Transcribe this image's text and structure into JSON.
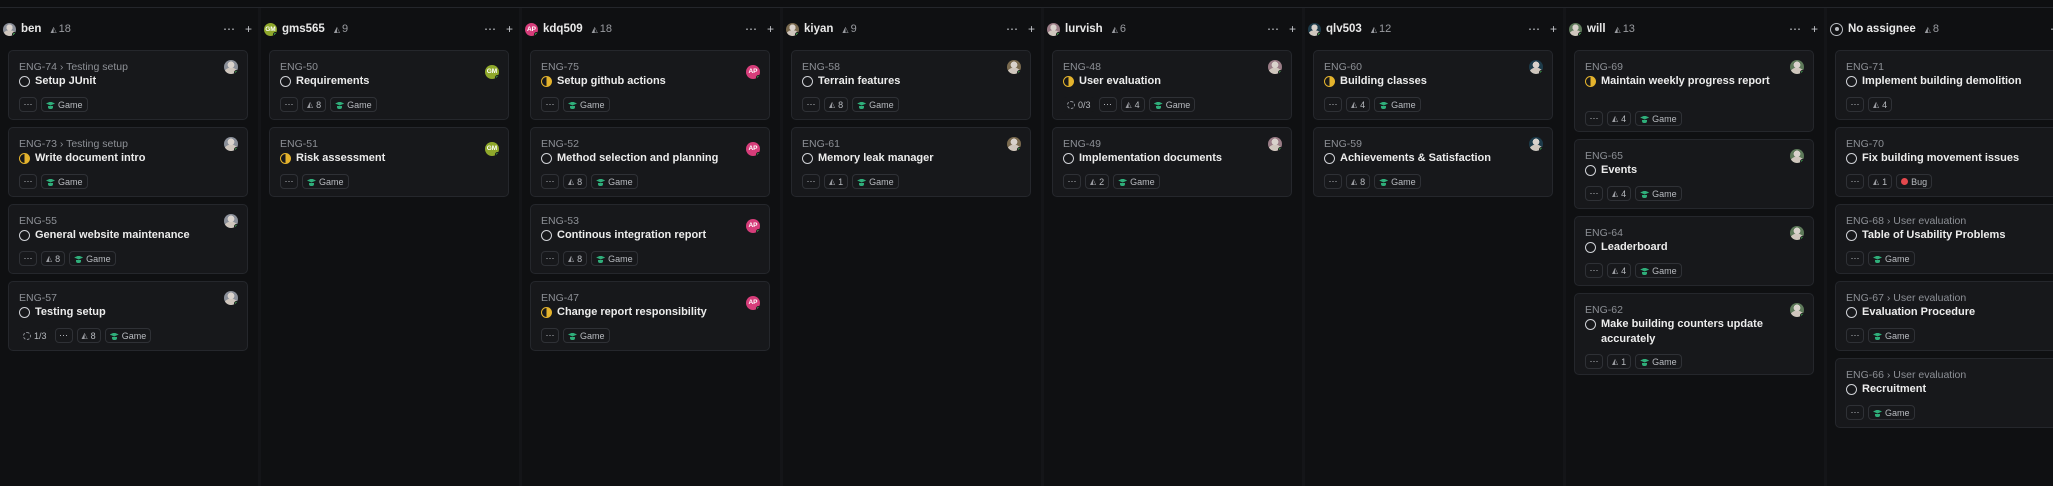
{
  "columns": [
    {
      "name": "ben",
      "estimate": "18",
      "avatar": {
        "initials": "",
        "color": "#8a8f99"
      },
      "cards": [
        {
          "id": "ENG-74",
          "parent": "Testing setup",
          "title": "Setup JUnit",
          "status": "todo",
          "props": [
            {
              "type": "more"
            },
            {
              "type": "label",
              "text": "Game"
            }
          ]
        },
        {
          "id": "ENG-73",
          "parent": "Testing setup",
          "title": "Write document intro",
          "status": "progress",
          "props": [
            {
              "type": "more"
            },
            {
              "type": "label",
              "text": "Game"
            }
          ]
        },
        {
          "id": "ENG-55",
          "parent": "",
          "title": "General website maintenance",
          "status": "todo",
          "props": [
            {
              "type": "more"
            },
            {
              "type": "estimate",
              "text": "8"
            },
            {
              "type": "label",
              "text": "Game"
            }
          ]
        },
        {
          "id": "ENG-57",
          "parent": "",
          "title": "Testing setup",
          "status": "todo",
          "props": [
            {
              "type": "subissues",
              "text": "1/3"
            },
            {
              "type": "more"
            },
            {
              "type": "estimate",
              "text": "8"
            },
            {
              "type": "label",
              "text": "Game"
            }
          ]
        }
      ]
    },
    {
      "name": "gms565",
      "estimate": "9",
      "avatar": {
        "initials": "GM",
        "color": "#8fa82b"
      },
      "cards": [
        {
          "id": "ENG-50",
          "parent": "",
          "title": "Requirements",
          "status": "todo",
          "props": [
            {
              "type": "more"
            },
            {
              "type": "estimate",
              "text": "8"
            },
            {
              "type": "label",
              "text": "Game"
            }
          ]
        },
        {
          "id": "ENG-51",
          "parent": "",
          "title": "Risk assessment",
          "status": "progress",
          "props": [
            {
              "type": "more"
            },
            {
              "type": "label",
              "text": "Game"
            }
          ]
        }
      ]
    },
    {
      "name": "kdq509",
      "estimate": "18",
      "avatar": {
        "initials": "AP",
        "color": "#d63d7a"
      },
      "cards": [
        {
          "id": "ENG-75",
          "parent": "",
          "title": "Setup github actions",
          "status": "progress",
          "props": [
            {
              "type": "more"
            },
            {
              "type": "label",
              "text": "Game"
            }
          ]
        },
        {
          "id": "ENG-52",
          "parent": "",
          "title": "Method selection and planning",
          "status": "todo",
          "props": [
            {
              "type": "more"
            },
            {
              "type": "estimate",
              "text": "8"
            },
            {
              "type": "label",
              "text": "Game"
            }
          ]
        },
        {
          "id": "ENG-53",
          "parent": "",
          "title": "Continous integration report",
          "status": "todo",
          "props": [
            {
              "type": "more"
            },
            {
              "type": "estimate",
              "text": "8"
            },
            {
              "type": "label",
              "text": "Game"
            }
          ]
        },
        {
          "id": "ENG-47",
          "parent": "",
          "title": "Change report responsibility",
          "status": "progress",
          "props": [
            {
              "type": "more"
            },
            {
              "type": "label",
              "text": "Game"
            }
          ]
        }
      ]
    },
    {
      "name": "kiyan",
      "estimate": "9",
      "avatar": {
        "initials": "",
        "color": "#7a6a4f"
      },
      "cards": [
        {
          "id": "ENG-58",
          "parent": "",
          "title": "Terrain features",
          "status": "todo",
          "props": [
            {
              "type": "more"
            },
            {
              "type": "estimate",
              "text": "8"
            },
            {
              "type": "label",
              "text": "Game"
            }
          ]
        },
        {
          "id": "ENG-61",
          "parent": "",
          "title": "Memory leak manager",
          "status": "todo",
          "props": [
            {
              "type": "more"
            },
            {
              "type": "estimate",
              "text": "1"
            },
            {
              "type": "label",
              "text": "Game"
            }
          ]
        }
      ]
    },
    {
      "name": "lurvish",
      "estimate": "6",
      "avatar": {
        "initials": "",
        "color": "#9a7c86"
      },
      "cards": [
        {
          "id": "ENG-48",
          "parent": "",
          "title": "User evaluation",
          "status": "progress",
          "props": [
            {
              "type": "subissues",
              "text": "0/3"
            },
            {
              "type": "more"
            },
            {
              "type": "estimate",
              "text": "4"
            },
            {
              "type": "label",
              "text": "Game"
            }
          ]
        },
        {
          "id": "ENG-49",
          "parent": "",
          "title": "Implementation documents",
          "status": "todo",
          "props": [
            {
              "type": "more"
            },
            {
              "type": "estimate",
              "text": "2"
            },
            {
              "type": "label",
              "text": "Game"
            }
          ]
        }
      ]
    },
    {
      "name": "qlv503",
      "estimate": "12",
      "avatar": {
        "initials": "",
        "color": "#1d3b4a"
      },
      "cards": [
        {
          "id": "ENG-60",
          "parent": "",
          "title": "Building classes",
          "status": "progress",
          "props": [
            {
              "type": "more"
            },
            {
              "type": "estimate",
              "text": "4"
            },
            {
              "type": "label",
              "text": "Game"
            }
          ]
        },
        {
          "id": "ENG-59",
          "parent": "",
          "title": "Achievements & Satisfaction",
          "status": "todo",
          "props": [
            {
              "type": "more"
            },
            {
              "type": "estimate",
              "text": "8"
            },
            {
              "type": "label",
              "text": "Game"
            }
          ]
        }
      ]
    },
    {
      "name": "will",
      "estimate": "13",
      "avatar": {
        "initials": "",
        "color": "#5e7a5a"
      },
      "cards": [
        {
          "id": "ENG-69",
          "parent": "",
          "title": "Maintain weekly progress report",
          "status": "progress",
          "props": [
            {
              "type": "more"
            },
            {
              "type": "estimate",
              "text": "4"
            },
            {
              "type": "label",
              "text": "Game"
            }
          ]
        },
        {
          "id": "ENG-65",
          "parent": "",
          "title": "Events",
          "status": "todo",
          "props": [
            {
              "type": "more"
            },
            {
              "type": "estimate",
              "text": "4"
            },
            {
              "type": "label",
              "text": "Game"
            }
          ]
        },
        {
          "id": "ENG-64",
          "parent": "",
          "title": "Leaderboard",
          "status": "todo",
          "props": [
            {
              "type": "more"
            },
            {
              "type": "estimate",
              "text": "4"
            },
            {
              "type": "label",
              "text": "Game"
            }
          ]
        },
        {
          "id": "ENG-62",
          "parent": "",
          "title": "Make building counters update accurately",
          "status": "todo",
          "props": [
            {
              "type": "more"
            },
            {
              "type": "estimate",
              "text": "1"
            },
            {
              "type": "label",
              "text": "Game"
            }
          ]
        }
      ]
    },
    {
      "name": "No assignee",
      "estimate": "8",
      "avatar": {
        "initials": "",
        "color": "none"
      },
      "cards": [
        {
          "id": "ENG-71",
          "parent": "",
          "title": "Implement building demolition",
          "status": "todo",
          "props": [
            {
              "type": "more"
            },
            {
              "type": "estimate",
              "text": "4"
            }
          ]
        },
        {
          "id": "ENG-70",
          "parent": "",
          "title": "Fix building movement issues",
          "status": "todo",
          "props": [
            {
              "type": "more"
            },
            {
              "type": "estimate",
              "text": "1"
            },
            {
              "type": "bug",
              "text": "Bug"
            }
          ]
        },
        {
          "id": "ENG-68",
          "parent": "User evaluation",
          "title": "Table of Usability Problems",
          "status": "todo",
          "props": [
            {
              "type": "more"
            },
            {
              "type": "label",
              "text": "Game"
            }
          ]
        },
        {
          "id": "ENG-67",
          "parent": "User evaluation",
          "title": "Evaluation Procedure",
          "status": "todo",
          "props": [
            {
              "type": "more"
            },
            {
              "type": "label",
              "text": "Game"
            }
          ]
        },
        {
          "id": "ENG-66",
          "parent": "User evaluation",
          "title": "Recruitment",
          "status": "todo",
          "props": [
            {
              "type": "more"
            },
            {
              "type": "label",
              "text": "Game"
            }
          ]
        }
      ]
    }
  ],
  "icons": {
    "more": "ellipsis-icon",
    "add": "plus-icon",
    "estimate": "estimate-icon",
    "label": "game-label-icon"
  },
  "colors": {
    "background": "#0e0f11",
    "card": "#17181b",
    "progress": "#e4b32d",
    "label": "#2fae7a",
    "bug": "#e5484d"
  }
}
